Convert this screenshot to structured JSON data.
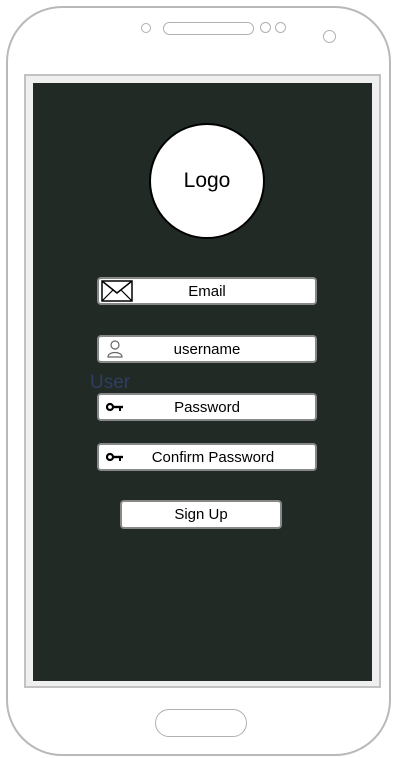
{
  "logo": {
    "label": "Logo"
  },
  "form": {
    "email": {
      "placeholder": "Email",
      "icon": "envelope-icon"
    },
    "username": {
      "placeholder": "username",
      "icon": "user-icon"
    },
    "password": {
      "placeholder": "Password",
      "icon": "key-icon"
    },
    "confirm_password": {
      "placeholder": "Confirm Password",
      "icon": "key-icon"
    },
    "hint_text": "User",
    "signup_label": "Sign Up"
  },
  "colors": {
    "screen_background": "#212a25",
    "field_background": "#ffffff",
    "hint_text": "#2f3e62"
  }
}
